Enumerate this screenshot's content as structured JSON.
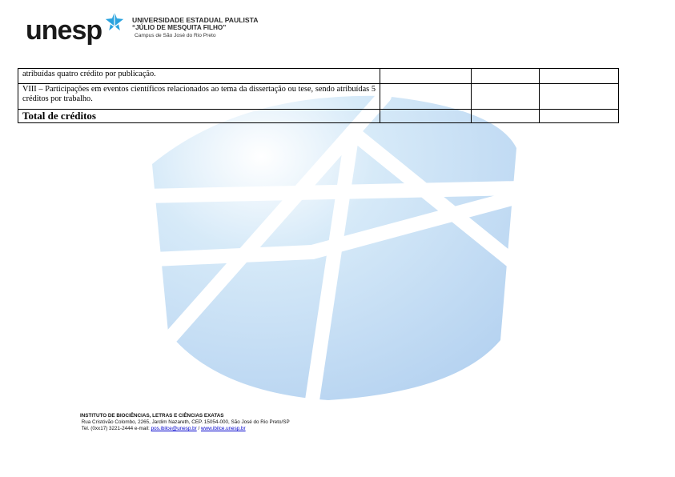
{
  "header": {
    "logo_text": "unesp",
    "university_name": "UNIVERSIDADE ESTADUAL PAULISTA",
    "university_subtitle": "“JÚLIO DE MESQUITA FILHO”",
    "campus": "Campus de São José do Rio Preto"
  },
  "table": {
    "rows": [
      {
        "description": "atribuídas quatro crédito por publicação."
      },
      {
        "description": "VIII – Participações em eventos científicos relacionados ao tema da dissertação ou tese, sendo atribuídas 5 créditos por trabalho."
      },
      {
        "description": "Total de créditos"
      }
    ]
  },
  "footer": {
    "institute": "INSTITUTO DE BIOCIÊNCIAS, LETRAS E CIÊNCIAS EXATAS",
    "address": "Rua Cristóvão Colombo, 2265, Jardim Nazareth, CEP. 15054-000, São José do Rio Preto/SP",
    "phone_email_prefix": "Tel. (0xx17) 3221-2444   e-mail:",
    "email": "pos.ibilce@unesp.br",
    "separator": "/",
    "website": "www.ibilce.unesp.br"
  },
  "colors": {
    "watermark_blue": "#9fc8ec",
    "logo_blue": "#2aa3df",
    "link_blue": "#0000cc"
  }
}
